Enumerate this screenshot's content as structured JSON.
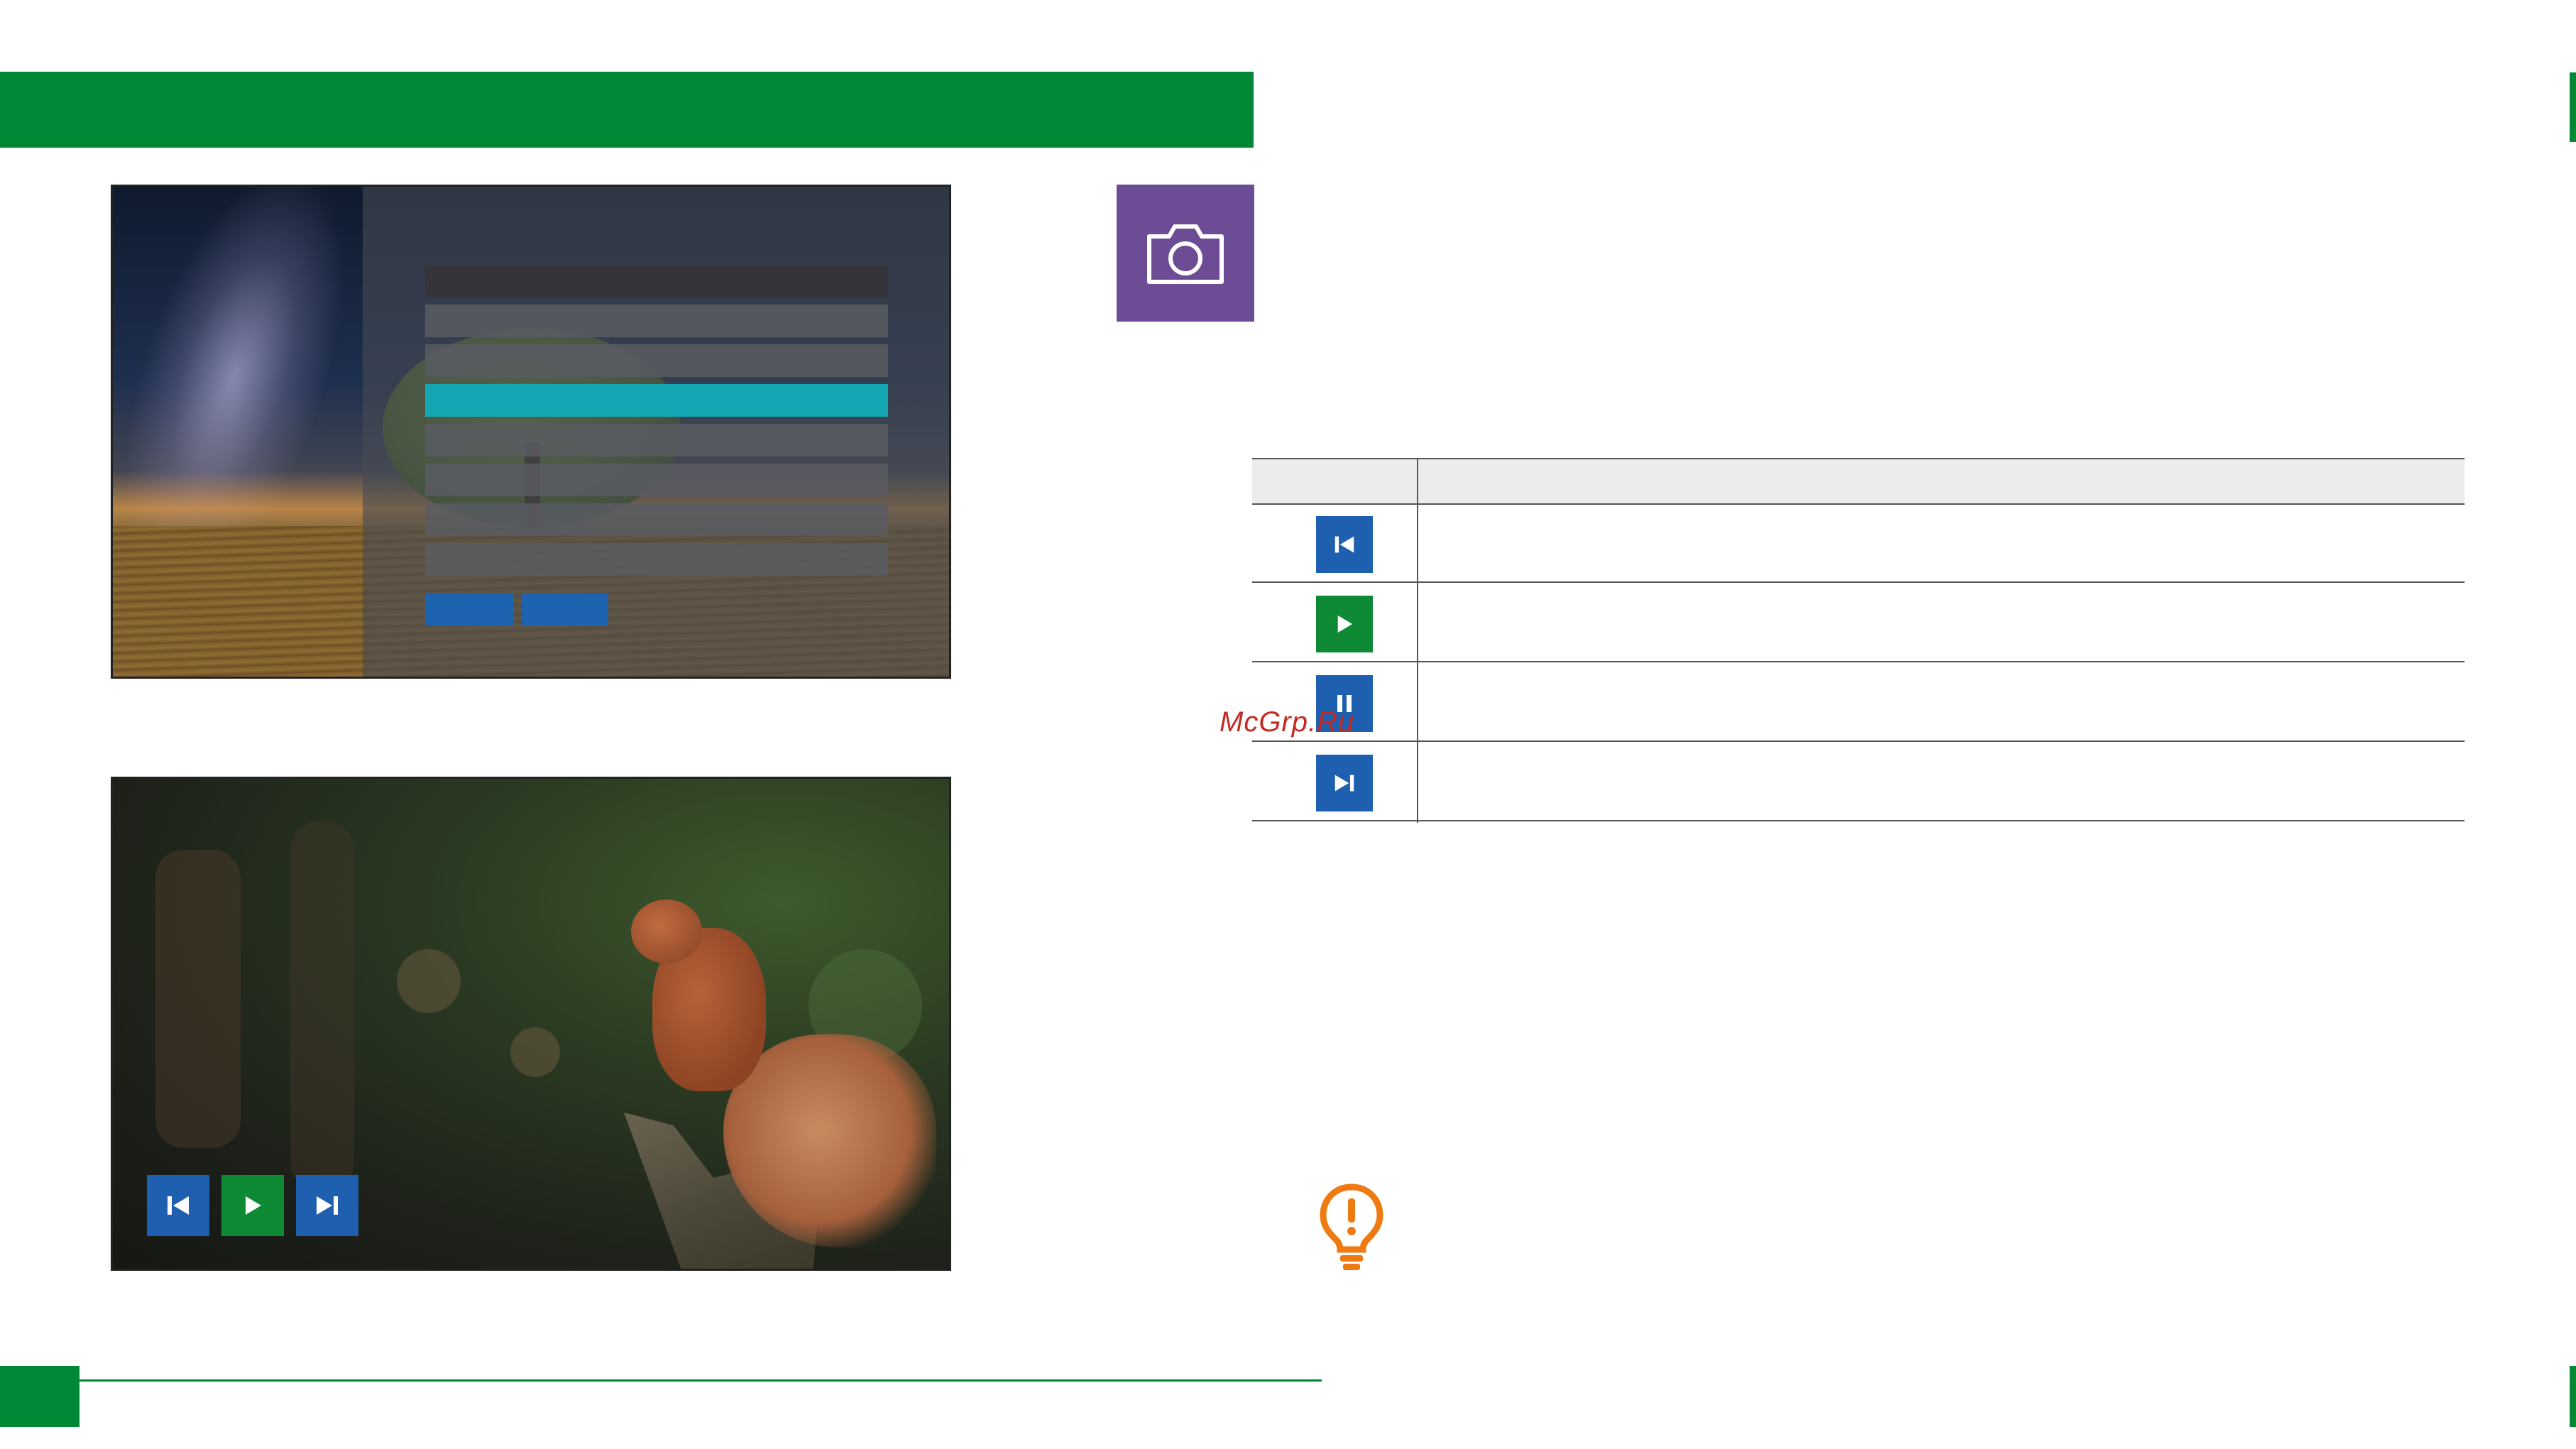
{
  "watermark": "McGrp.Ru",
  "header": {
    "color": "#008837"
  },
  "badge": {
    "icon": "camera-icon",
    "color": "#6d4c96"
  },
  "slideshow_controls": [
    {
      "icon": "skip-previous-icon",
      "color": "#1f5fb0"
    },
    {
      "icon": "play-icon",
      "color": "#0e8a35"
    },
    {
      "icon": "skip-next-icon",
      "color": "#1f5fb0"
    }
  ],
  "table": {
    "rows": [
      {
        "icon": "skip-previous-icon",
        "color": "#1f5fb0"
      },
      {
        "icon": "play-icon",
        "color": "#0e8a35"
      },
      {
        "icon": "pause-icon",
        "color": "#1f5fb0"
      },
      {
        "icon": "skip-next-icon",
        "color": "#1f5fb0"
      }
    ]
  },
  "tip": {
    "icon": "lightbulb-warning-icon",
    "color": "#f07a12"
  }
}
